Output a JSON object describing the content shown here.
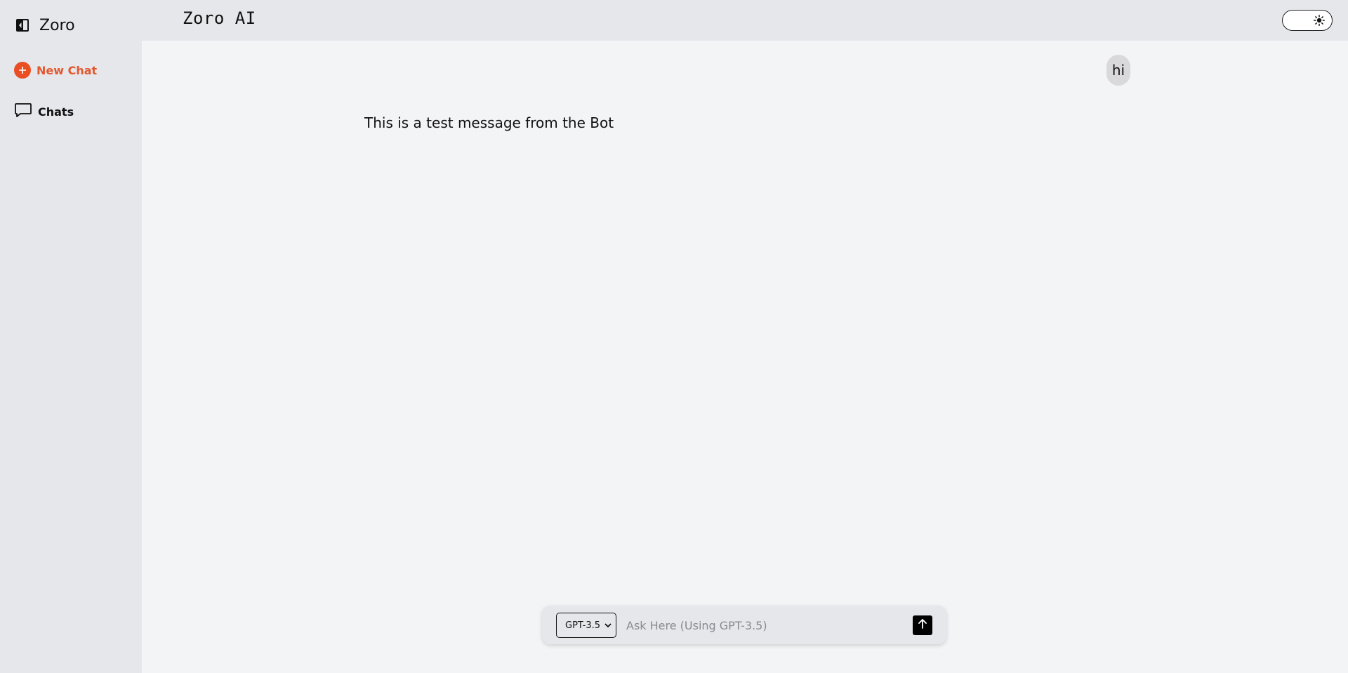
{
  "sidebar": {
    "brand_name": "Zoro",
    "new_chat_label": "New Chat",
    "chats_label": "Chats"
  },
  "header": {
    "title": "Zoro AI"
  },
  "conversation": {
    "user_message": "hi",
    "bot_message": "This is a test message from the Bot"
  },
  "composer": {
    "model_selected": "GPT-3.5",
    "placeholder": "Ask Here (Using GPT-3.5)",
    "value": ""
  },
  "colors": {
    "accent": "#ea4f24",
    "sidebar_bg": "#e5e7eb",
    "main_bg": "#f3f4f6"
  },
  "icons": {
    "brand": "sidebar-toggle-icon",
    "new_chat": "plus-circle-icon",
    "chats": "chat-bubble-icon",
    "theme": "sun-icon",
    "send": "arrow-up-icon"
  }
}
